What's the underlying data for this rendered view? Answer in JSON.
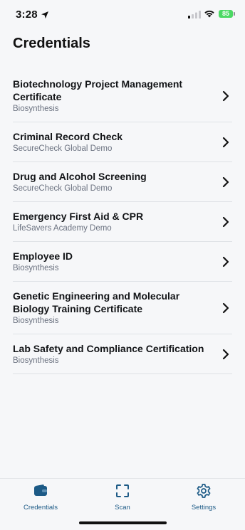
{
  "status": {
    "time": "3:28",
    "battery": "85"
  },
  "page": {
    "title": "Credentials"
  },
  "credentials": [
    {
      "title": "Biotechnology Project Management Certificate",
      "issuer": "Biosynthesis"
    },
    {
      "title": "Criminal Record Check",
      "issuer": "SecureCheck Global Demo"
    },
    {
      "title": "Drug and Alcohol Screening",
      "issuer": "SecureCheck Global Demo"
    },
    {
      "title": "Emergency First Aid & CPR",
      "issuer": "LifeSavers Academy Demo"
    },
    {
      "title": "Employee ID",
      "issuer": "Biosynthesis"
    },
    {
      "title": "Genetic Engineering and Molecular Biology Training Certificate",
      "issuer": "Biosynthesis"
    },
    {
      "title": "Lab Safety and Compliance Certification",
      "issuer": "Biosynthesis"
    }
  ],
  "tabs": [
    {
      "label": "Credentials",
      "icon": "wallet-icon"
    },
    {
      "label": "Scan",
      "icon": "scan-icon"
    },
    {
      "label": "Settings",
      "icon": "gear-icon"
    }
  ],
  "colors": {
    "accent": "#1c5a86",
    "background": "#f6f7f9",
    "battery": "#4cd964"
  }
}
